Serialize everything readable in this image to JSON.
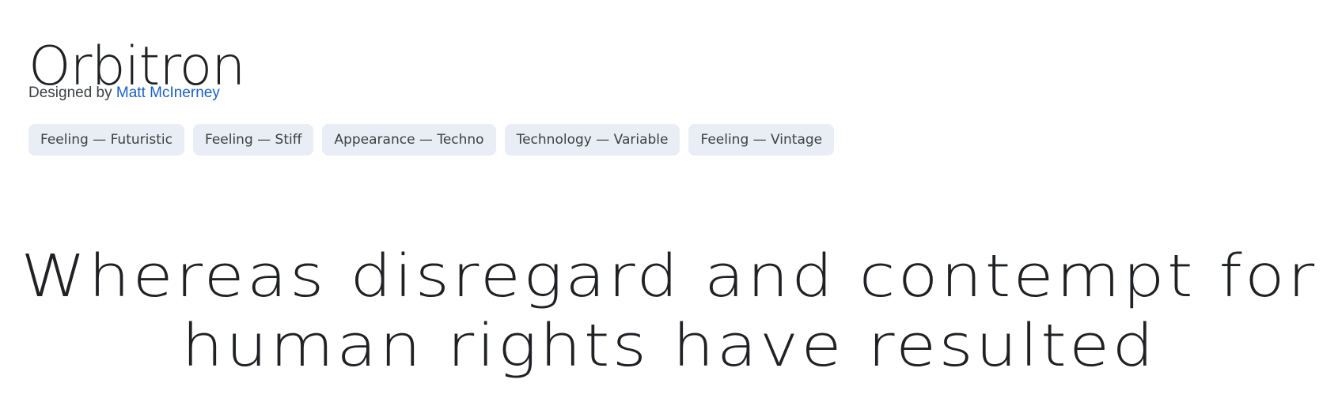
{
  "font": {
    "name": "Orbitron",
    "designed_by_prefix": "Designed by",
    "designer": "Matt McInerney"
  },
  "tags": [
    {
      "label": "Feeling — Futuristic"
    },
    {
      "label": "Feeling — Stiff"
    },
    {
      "label": "Appearance — Techno"
    },
    {
      "label": "Technology — Variable"
    },
    {
      "label": "Feeling — Vintage"
    }
  ],
  "sample": {
    "line1": "Whereas disregard and contempt for",
    "line2": "human rights have resulted"
  },
  "colors": {
    "text": "#202124",
    "link": "#1a5fc7",
    "tag_background": "#e9eef6"
  }
}
